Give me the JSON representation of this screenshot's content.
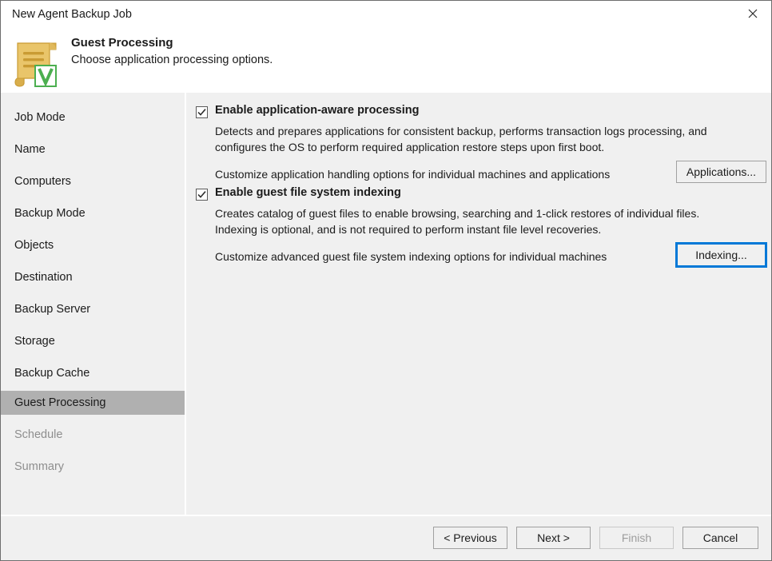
{
  "window": {
    "title": "New Agent Backup Job",
    "close_label": "Close"
  },
  "header": {
    "title": "Guest Processing",
    "subtitle": "Choose application processing options.",
    "icon": "document-scroll-veeam-icon"
  },
  "sidebar": {
    "items": [
      {
        "label": "Job Mode",
        "state": "normal"
      },
      {
        "label": "Name",
        "state": "normal"
      },
      {
        "label": "Computers",
        "state": "normal"
      },
      {
        "label": "Backup Mode",
        "state": "normal"
      },
      {
        "label": "Objects",
        "state": "normal"
      },
      {
        "label": "Destination",
        "state": "normal"
      },
      {
        "label": "Backup Server",
        "state": "normal"
      },
      {
        "label": "Storage",
        "state": "normal"
      },
      {
        "label": "Backup Cache",
        "state": "normal"
      },
      {
        "label": "Guest Processing",
        "state": "selected"
      },
      {
        "label": "Schedule",
        "state": "disabled"
      },
      {
        "label": "Summary",
        "state": "disabled"
      }
    ]
  },
  "main": {
    "application_aware": {
      "checkbox_label": "Enable application-aware processing",
      "checked": true,
      "description_line1": "Detects and prepares applications for consistent backup, performs transaction logs processing, and",
      "description_line2": "configures the OS to perform required application restore steps upon first boot.",
      "customize_text": "Customize application handling options for individual machines and applications",
      "button_label": "Applications...",
      "button_focused": false
    },
    "guest_indexing": {
      "checkbox_label": "Enable guest file system indexing",
      "checked": true,
      "description_line1": "Creates catalog of guest files to enable browsing, searching and 1-click restores of individual files.",
      "description_line2": "Indexing is optional, and is not required to perform instant file level recoveries.",
      "customize_text": "Customize advanced guest file system indexing options for individual machines",
      "button_label": "Indexing...",
      "button_focused": true
    }
  },
  "footer": {
    "previous_label": "< Previous",
    "next_label": "Next >",
    "finish_label": "Finish",
    "cancel_label": "Cancel",
    "finish_disabled": true
  },
  "colors": {
    "accent_focus": "#0078d7",
    "panel_background": "#f0f0f0",
    "selected_nav": "#b0b0b0",
    "icon_gold": "#e3b34a",
    "icon_green": "#4caf50"
  }
}
